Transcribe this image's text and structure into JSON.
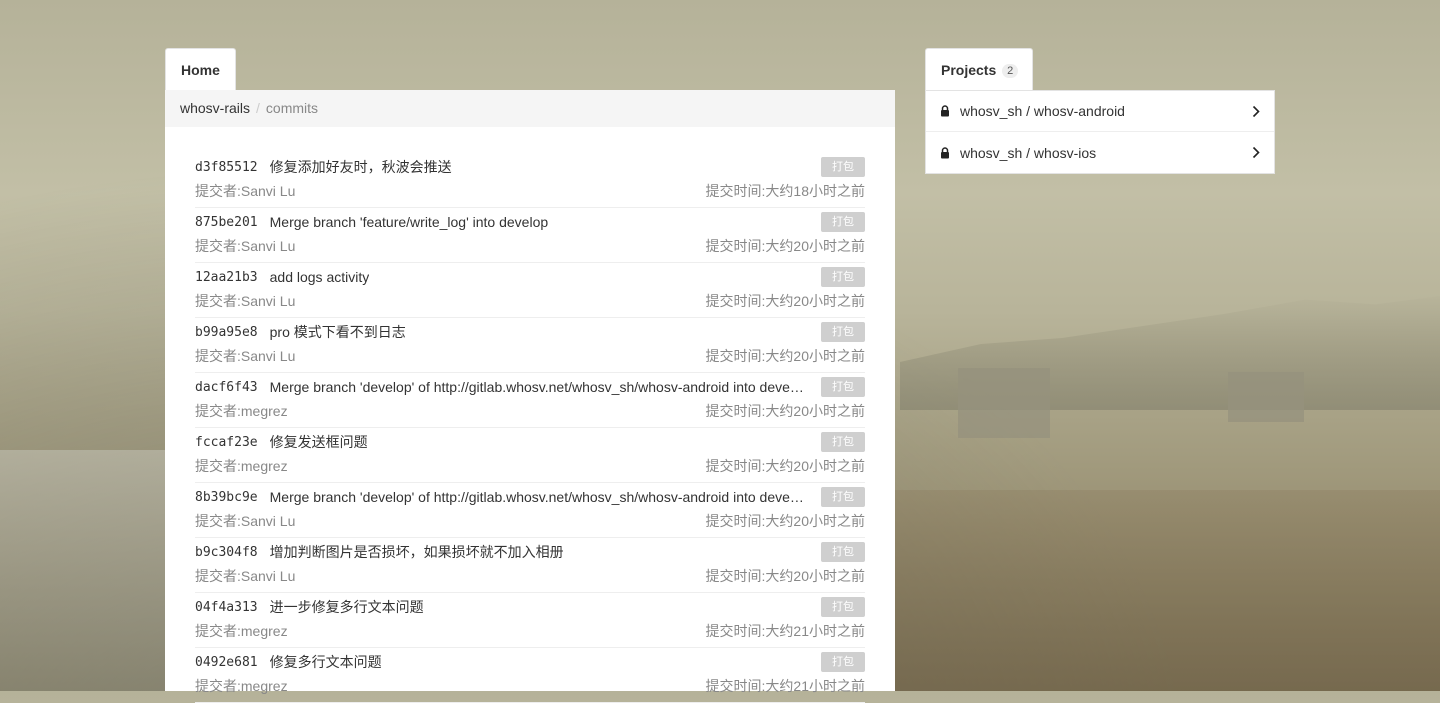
{
  "home_tab": {
    "label": "Home"
  },
  "breadcrumb": {
    "repo": "whosv-rails",
    "separator": "/",
    "current": "commits"
  },
  "commits": [
    {
      "sha": "d3f85512",
      "message": "修复添加好友时，秋波会推送",
      "author": "提交者:Sanvi Lu",
      "time": "提交时间:大约18小时之前",
      "action": "打包"
    },
    {
      "sha": "875be201",
      "message": "Merge branch 'feature/write_log' into develop",
      "author": "提交者:Sanvi Lu",
      "time": "提交时间:大约20小时之前",
      "action": "打包"
    },
    {
      "sha": "12aa21b3",
      "message": "add logs activity",
      "author": "提交者:Sanvi Lu",
      "time": "提交时间:大约20小时之前",
      "action": "打包"
    },
    {
      "sha": "b99a95e8",
      "message": "pro 模式下看不到日志",
      "author": "提交者:Sanvi Lu",
      "time": "提交时间:大约20小时之前",
      "action": "打包"
    },
    {
      "sha": "dacf6f43",
      "message": "Merge branch 'develop' of http://gitlab.whosv.net/whosv_sh/whosv-android into develop",
      "author": "提交者:megrez",
      "time": "提交时间:大约20小时之前",
      "action": "打包"
    },
    {
      "sha": "fccaf23e",
      "message": "修复发送框问题",
      "author": "提交者:megrez",
      "time": "提交时间:大约20小时之前",
      "action": "打包"
    },
    {
      "sha": "8b39bc9e",
      "message": "Merge branch 'develop' of http://gitlab.whosv.net/whosv_sh/whosv-android into develop",
      "author": "提交者:Sanvi Lu",
      "time": "提交时间:大约20小时之前",
      "action": "打包"
    },
    {
      "sha": "b9c304f8",
      "message": "增加判断图片是否损坏，如果损坏就不加入相册",
      "author": "提交者:Sanvi Lu",
      "time": "提交时间:大约20小时之前",
      "action": "打包"
    },
    {
      "sha": "04f4a313",
      "message": "进一步修复多行文本问题",
      "author": "提交者:megrez",
      "time": "提交时间:大约21小时之前",
      "action": "打包"
    },
    {
      "sha": "0492e681",
      "message": "修复多行文本问题",
      "author": "提交者:megrez",
      "time": "提交时间:大约21小时之前",
      "action": "打包"
    }
  ],
  "projects_tab": {
    "label": "Projects",
    "count": "2"
  },
  "projects": [
    {
      "name": "whosv_sh / whosv-android",
      "icon": "lock-icon"
    },
    {
      "name": "whosv_sh / whosv-ios",
      "icon": "lock-icon"
    }
  ],
  "colors": {
    "pack_button": "#cfcfcf",
    "muted_text": "#888888",
    "breadcrumb_bg": "#f5f5f5"
  }
}
